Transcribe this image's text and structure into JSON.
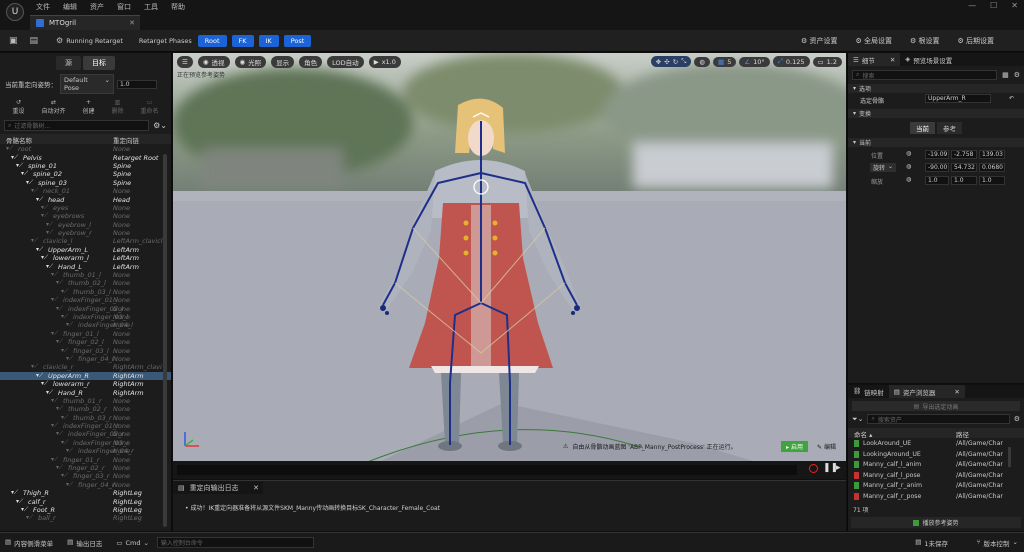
{
  "app": {
    "logo": "U",
    "window_controls": [
      "—",
      "☐",
      "✕"
    ]
  },
  "menu": [
    "文件",
    "编辑",
    "资产",
    "窗口",
    "工具",
    "帮助"
  ],
  "document_tab": "MTOgril",
  "toolbar": {
    "running_retarget": "Running Retarget",
    "retarget_phases": "Retarget Phases",
    "phases": [
      "Root",
      "FK",
      "IK",
      "Post"
    ],
    "right_buttons": [
      "资产设置",
      "全局设置",
      "根设置",
      "后期设置"
    ]
  },
  "left_panel": {
    "tabs": [
      "源",
      "目标"
    ],
    "pose_label": "当前重定向姿势：",
    "pose_value": "Default Pose",
    "pose_scale": "1.0",
    "actions": [
      "重设",
      "自动对齐",
      "创建",
      "删除",
      "重命名"
    ],
    "search_placeholder": "过滤骨骼树...",
    "col_bone": "骨骼名称",
    "col_chain": "重定向链",
    "rows": [
      {
        "depth": 0,
        "name": "root",
        "chain": "None",
        "state": "dim"
      },
      {
        "depth": 1,
        "name": "Pelvis",
        "chain": "Retarget Root",
        "state": "bright"
      },
      {
        "depth": 2,
        "name": "spine_01",
        "chain": "Spine",
        "state": "bright"
      },
      {
        "depth": 3,
        "name": "spine_02",
        "chain": "Spine",
        "state": "bright"
      },
      {
        "depth": 4,
        "name": "spine_03",
        "chain": "Spine",
        "state": "bright"
      },
      {
        "depth": 5,
        "name": "neck_01",
        "chain": "None",
        "state": "dim"
      },
      {
        "depth": 6,
        "name": "head",
        "chain": "Head",
        "state": "bright"
      },
      {
        "depth": 7,
        "name": "eyes",
        "chain": "None",
        "state": "dim"
      },
      {
        "depth": 7,
        "name": "eyebrows",
        "chain": "None",
        "state": "dim"
      },
      {
        "depth": 8,
        "name": "eyebrow_l",
        "chain": "None",
        "state": "dim"
      },
      {
        "depth": 8,
        "name": "eyebrow_r",
        "chain": "None",
        "state": "dim"
      },
      {
        "depth": 5,
        "name": "clavicle_l",
        "chain": "LeftArm_clavicl",
        "state": "dim"
      },
      {
        "depth": 6,
        "name": "UpperArm_L",
        "chain": "LeftArm",
        "state": "bright"
      },
      {
        "depth": 7,
        "name": "lowerarm_l",
        "chain": "LeftArm",
        "state": "bright"
      },
      {
        "depth": 8,
        "name": "Hand_L",
        "chain": "LeftArm",
        "state": "bright"
      },
      {
        "depth": 9,
        "name": "thumb_01_l",
        "chain": "None",
        "state": "dim"
      },
      {
        "depth": 10,
        "name": "thumb_02_l",
        "chain": "None",
        "state": "dim"
      },
      {
        "depth": 11,
        "name": "thumb_03_l",
        "chain": "None",
        "state": "dim"
      },
      {
        "depth": 9,
        "name": "indexFinger_01_l",
        "chain": "None",
        "state": "dim"
      },
      {
        "depth": 10,
        "name": "indexFinger_02_l",
        "chain": "None",
        "state": "dim"
      },
      {
        "depth": 11,
        "name": "indexFinger_03_l",
        "chain": "None",
        "state": "dim"
      },
      {
        "depth": 12,
        "name": "indexFinger_04_l",
        "chain": "None",
        "state": "dim"
      },
      {
        "depth": 9,
        "name": "finger_01_l",
        "chain": "None",
        "state": "dim"
      },
      {
        "depth": 10,
        "name": "finger_02_l",
        "chain": "None",
        "state": "dim"
      },
      {
        "depth": 11,
        "name": "finger_03_l",
        "chain": "None",
        "state": "dim"
      },
      {
        "depth": 12,
        "name": "finger_04_l",
        "chain": "None",
        "state": "dim"
      },
      {
        "depth": 5,
        "name": "clavicle_r",
        "chain": "RightArm_clavi",
        "state": "dim"
      },
      {
        "depth": 6,
        "name": "UpperArm_R",
        "chain": "RightArm",
        "state": "selected"
      },
      {
        "depth": 7,
        "name": "lowerarm_r",
        "chain": "RightArm",
        "state": "bright"
      },
      {
        "depth": 8,
        "name": "Hand_R",
        "chain": "RightArm",
        "state": "bright"
      },
      {
        "depth": 9,
        "name": "thumb_01_r",
        "chain": "None",
        "state": "dim"
      },
      {
        "depth": 10,
        "name": "thumb_02_r",
        "chain": "None",
        "state": "dim"
      },
      {
        "depth": 11,
        "name": "thumb_03_r",
        "chain": "None",
        "state": "dim"
      },
      {
        "depth": 9,
        "name": "indexFinger_01_r",
        "chain": "None",
        "state": "dim"
      },
      {
        "depth": 10,
        "name": "indexFinger_02_r",
        "chain": "None",
        "state": "dim"
      },
      {
        "depth": 11,
        "name": "indexFinger_03_r",
        "chain": "None",
        "state": "dim"
      },
      {
        "depth": 12,
        "name": "indexFinger_04_r",
        "chain": "None",
        "state": "dim"
      },
      {
        "depth": 9,
        "name": "finger_01_r",
        "chain": "None",
        "state": "dim"
      },
      {
        "depth": 10,
        "name": "finger_02_r",
        "chain": "None",
        "state": "dim"
      },
      {
        "depth": 11,
        "name": "finger_03_r",
        "chain": "None",
        "state": "dim"
      },
      {
        "depth": 12,
        "name": "finger_04_r",
        "chain": "None",
        "state": "dim"
      },
      {
        "depth": 1,
        "name": "Thigh_R",
        "chain": "RightLeg",
        "state": "bright"
      },
      {
        "depth": 2,
        "name": "calf_r",
        "chain": "RightLeg",
        "state": "bright"
      },
      {
        "depth": 3,
        "name": "Foot_R",
        "chain": "RightLeg",
        "state": "bright"
      },
      {
        "depth": 4,
        "name": "ball_r",
        "chain": "RightLeg",
        "state": "dim"
      }
    ]
  },
  "viewport": {
    "buttons": [
      "透视",
      "光照",
      "显示",
      "角色",
      "LOD自动"
    ],
    "speed": "x1.0",
    "grid": "5",
    "angle": "10°",
    "scale": "0.125",
    "cam": "1.2",
    "overlay_text": "正在预览参考姿势",
    "notification": "自由从骨骼动画蓝图 'ABP_Manny_PostProcess' 正在运行。",
    "notif_enable": "启用",
    "notif_edit": "编辑",
    "colors": {
      "notification": "#e2a412",
      "enable_btn": "#3fa33f"
    }
  },
  "log_panel": {
    "tab": "重定向输出日志",
    "message": "成功！IK重定向器准备将从源文件SKM_Manny传动画转换目标SK_Character_Female_Coat"
  },
  "details": {
    "tab1": "细节",
    "tab2": "预览场景设置",
    "search_placeholder": "搜索",
    "section_selection": "选项",
    "selected_bone_label": "选定骨骼",
    "selected_bone_value": "UpperArm_R",
    "section_transform": "变换",
    "toggle_current": "当前",
    "toggle_ref": "参考",
    "section_current": "当前",
    "loc_label": "位置",
    "loc": [
      "-19.09",
      "-2.758",
      "139.03"
    ],
    "rot_label": "旋转",
    "rot": [
      "-90.00",
      "54.732",
      "0.0680"
    ],
    "scale_label": "缩放",
    "scale": [
      "1.0",
      "1.0",
      "1.0"
    ]
  },
  "assets": {
    "tab1": "链映射",
    "tab2": "资产浏览器",
    "export_btn": "导出选定动画",
    "search_placeholder": "搜索资产",
    "col_name": "命名 ▴",
    "col_path": "路径",
    "items": [
      {
        "name": "LookAround_UE",
        "path": "/All/Game/Char",
        "color": "#3c9a3c"
      },
      {
        "name": "LookingAround_UE",
        "path": "/All/Game/Char",
        "color": "#3c9a3c"
      },
      {
        "name": "Manny_calf_l_anim",
        "path": "/All/Game/Char",
        "color": "#3c9a3c"
      },
      {
        "name": "Manny_calf_l_pose",
        "path": "/All/Game/Char",
        "color": "#c43232"
      },
      {
        "name": "Manny_calf_r_anim",
        "path": "/All/Game/Char",
        "color": "#3c9a3c"
      },
      {
        "name": "Manny_calf_r_pose",
        "path": "/All/Game/Char",
        "color": "#c43232"
      }
    ],
    "count": "71 项",
    "play_btn": "播放参考姿势"
  },
  "statusbar": {
    "content_drawer": "内容侧滑菜单",
    "output_log": "输出日志",
    "cmd": "Cmd",
    "cmd_placeholder": "输入控制台命令",
    "unsaved": "1未保存",
    "source_control": "版本控制"
  }
}
